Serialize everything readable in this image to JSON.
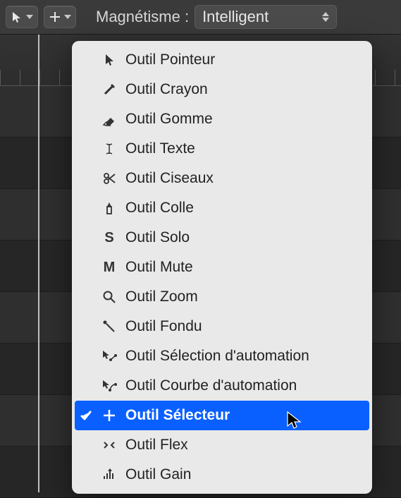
{
  "toolbar": {
    "snap_label": "Magnétisme :",
    "snap_value": "Intelligent"
  },
  "menu": {
    "items": [
      {
        "id": "pointer",
        "label": "Outil Pointeur"
      },
      {
        "id": "pencil",
        "label": "Outil Crayon"
      },
      {
        "id": "eraser",
        "label": "Outil Gomme"
      },
      {
        "id": "text",
        "label": "Outil Texte"
      },
      {
        "id": "scissors",
        "label": "Outil Ciseaux"
      },
      {
        "id": "glue",
        "label": "Outil Colle"
      },
      {
        "id": "solo",
        "label": "Outil Solo"
      },
      {
        "id": "mute",
        "label": "Outil Mute"
      },
      {
        "id": "zoom",
        "label": "Outil Zoom"
      },
      {
        "id": "fade",
        "label": "Outil Fondu"
      },
      {
        "id": "automation-select",
        "label": "Outil Sélection d'automation"
      },
      {
        "id": "automation-curve",
        "label": "Outil Courbe d'automation"
      },
      {
        "id": "marquee",
        "label": "Outil Sélecteur",
        "selected": true
      },
      {
        "id": "flex",
        "label": "Outil Flex"
      },
      {
        "id": "gain",
        "label": "Outil Gain"
      }
    ]
  }
}
